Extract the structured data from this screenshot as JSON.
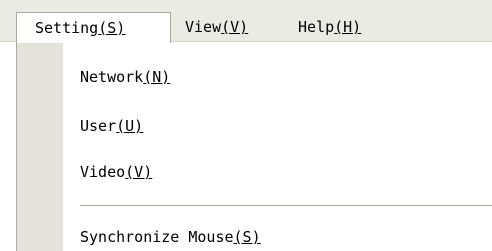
{
  "menubar": {
    "items": [
      {
        "label": "Setting",
        "mnemonic": "(S)"
      },
      {
        "label": "View",
        "mnemonic": "(V)"
      },
      {
        "label": "Help",
        "mnemonic": "(H)"
      }
    ]
  },
  "dropdown": {
    "items": [
      {
        "label": "Network",
        "mnemonic": "(N)"
      },
      {
        "label": "User",
        "mnemonic": "(U)"
      },
      {
        "label": "Video",
        "mnemonic": "(V)"
      },
      {
        "label": "Synchronize Mouse",
        "mnemonic": "(S)"
      }
    ]
  },
  "colors": {
    "menubar_bg": "#ecebe3",
    "gutter_bg": "#e5e3d9",
    "border": "#aca899"
  }
}
